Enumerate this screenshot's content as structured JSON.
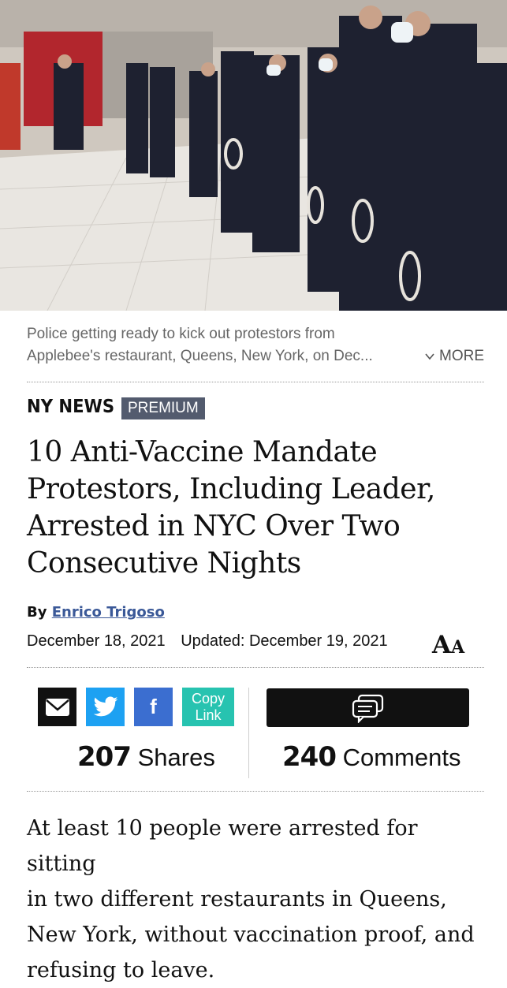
{
  "hero": {
    "image_alt": "Police officers lined up inside a shopping mall"
  },
  "caption": {
    "line1": "Police getting ready to kick out protestors from",
    "line2": "Applebee's restaurant, Queens, New York, on Dec...",
    "more_label": "MORE"
  },
  "section": {
    "label": "NY NEWS",
    "badge": "PREMIUM"
  },
  "headline": {
    "line1": "10 Anti-Vaccine Mandate",
    "line2": "Protestors, Including Leader,",
    "line3": "Arrested in NYC Over Two",
    "line4": "Consecutive Nights"
  },
  "byline": {
    "prefix": "By",
    "author": "Enrico Trigoso"
  },
  "dates": {
    "published": "December 18, 2021",
    "updated": "Updated: December 19, 2021"
  },
  "font_control": {
    "big": "A",
    "small": "A"
  },
  "share": {
    "copy_line1": "Copy",
    "copy_line2": "Link",
    "fb_label": "f",
    "shares_count": "207",
    "shares_label": "Shares",
    "comments_count": "240",
    "comments_label": "Comments"
  },
  "body": {
    "line1": "At least 10 people were arrested for sitting",
    "line2": "in two different restaurants in Queens,",
    "line3": "New York, without vaccination proof, and",
    "line4": "refusing to leave."
  },
  "colors": {
    "twitter": "#1da1f2",
    "facebook": "#3b6ed0",
    "copy": "#27c3b0",
    "badge": "#535b6e",
    "link": "#3b5998"
  }
}
